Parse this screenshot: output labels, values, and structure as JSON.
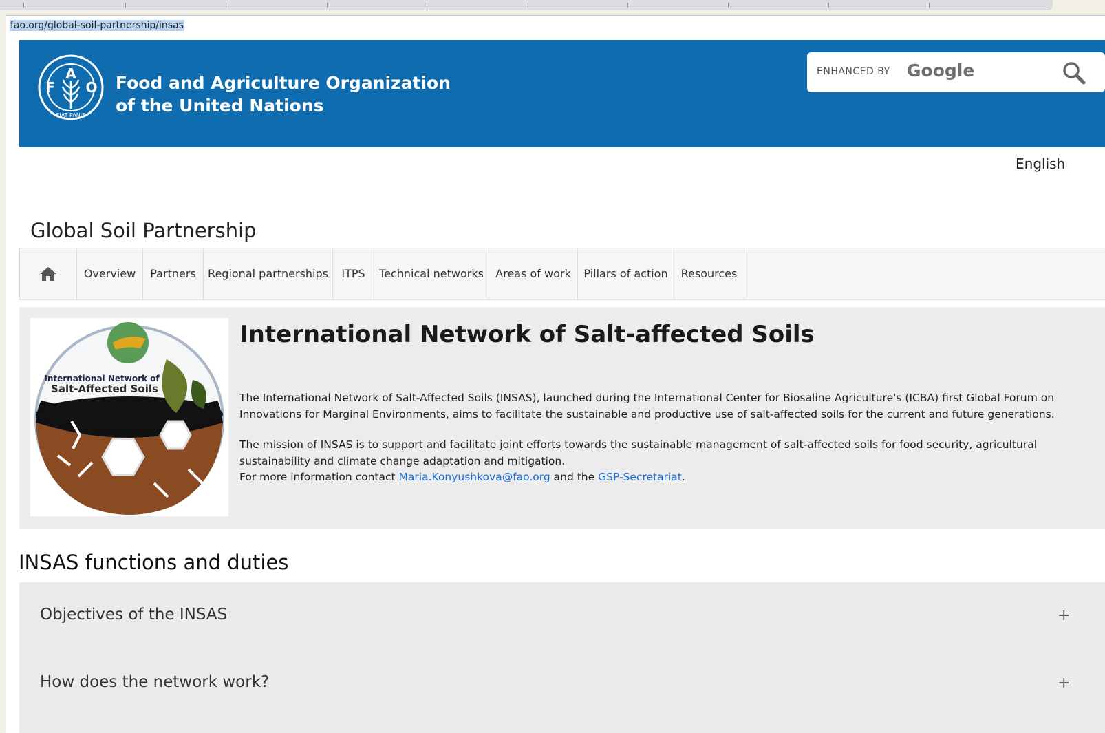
{
  "browser": {
    "url": "fao.org/global-soil-partnership/insas"
  },
  "header": {
    "org_name_line1": "Food and Agriculture Organization",
    "org_name_line2": "of the United Nations",
    "logo_text_left": "F",
    "logo_text_center": "A",
    "logo_text_right": "O",
    "logo_text_motto": "FIAT PANIS",
    "search_enhanced_label": "ENHANCED BY",
    "search_google_label": "Google"
  },
  "lang": "English",
  "site_title": "Global Soil Partnership",
  "nav": {
    "items": [
      {
        "label": "Overview"
      },
      {
        "label": "Partners"
      },
      {
        "label": "Regional partnerships"
      },
      {
        "label": "ITPS"
      },
      {
        "label": "Technical networks"
      },
      {
        "label": "Areas of work"
      },
      {
        "label": "Pillars of action"
      },
      {
        "label": "Resources"
      }
    ]
  },
  "hero": {
    "logo_text_line1": "International Network of",
    "logo_text_line2": "Salt-Affected Soils",
    "title": "International Network of Salt-affected Soils",
    "p1": "The International Network of Salt-Affected Soils (INSAS), launched during the International Center for Biosaline Agriculture's (ICBA) first Global Forum on Innovations for Marginal Environments, aims to facilitate the sustainable and productive use of salt-affected soils for the current and future generations.",
    "p2": "The mission of INSAS is to support and facilitate joint efforts towards the sustainable management of salt-affected soils for food security, agricultural sustainability and climate change adaptation and mitigation.",
    "p3_before": "For more information contact ",
    "p3_link1": "Maria.Konyushkova@fao.org",
    "p3_between": " and the ",
    "p3_link2": "GSP-Secretariat",
    "p3_after": "."
  },
  "section": {
    "title": "INSAS functions and duties",
    "accordion": [
      {
        "label": "Objectives of the INSAS",
        "toggle": "+"
      },
      {
        "label": "How does the network work?",
        "toggle": "+"
      }
    ]
  }
}
